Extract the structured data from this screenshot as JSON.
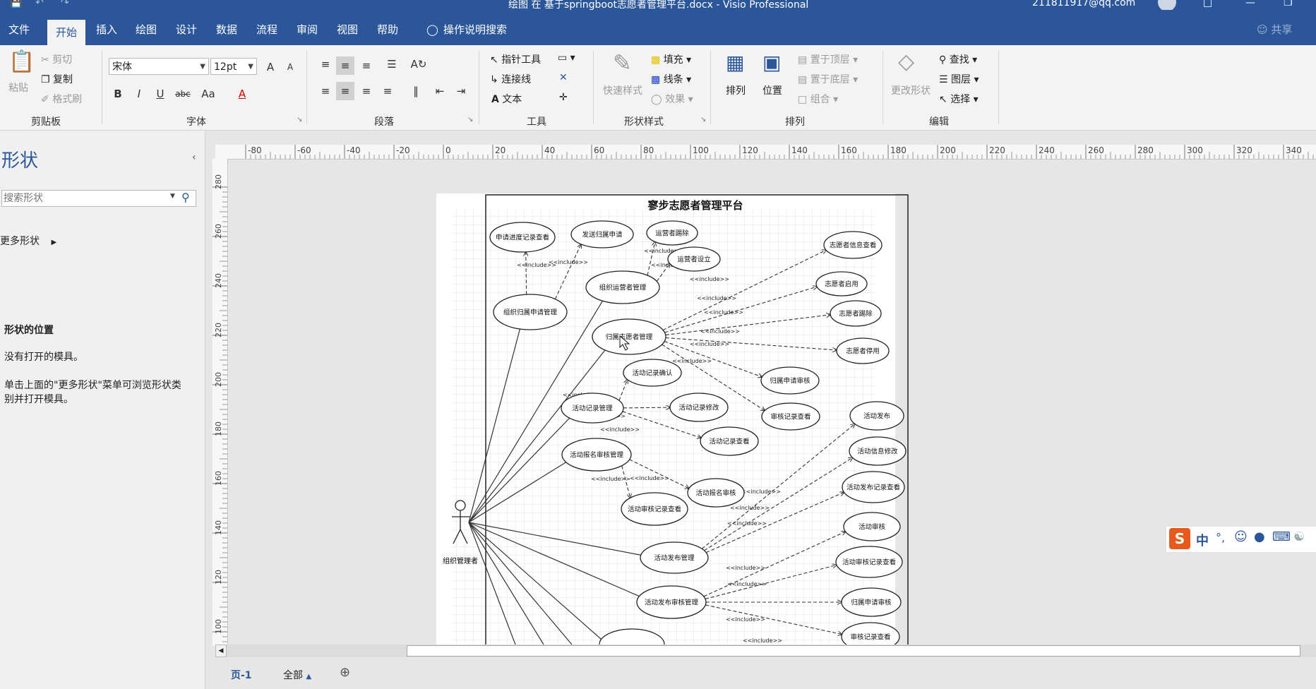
{
  "window": {
    "title": "绘图 在 基于springboot志愿者管理平台.docx  -  Visio Professional",
    "account": "211811917@qq.com"
  },
  "menu": {
    "tabs": [
      "文件",
      "开始",
      "插入",
      "绘图",
      "设计",
      "数据",
      "流程",
      "审阅",
      "视图",
      "帮助"
    ],
    "active": "开始",
    "tell_me": "操作说明搜索",
    "share": "共享"
  },
  "ribbon": {
    "clipboard": {
      "paste": "粘贴",
      "cut": "剪切",
      "copy": "复制",
      "format_painter": "格式刷",
      "label": "剪贴板"
    },
    "font": {
      "name": "宋体",
      "size": "12pt",
      "label": "字体",
      "grow": "A",
      "shrink": "A",
      "bold": "B",
      "italic": "I",
      "underline": "U",
      "strike": "abc",
      "case": "Aa",
      "color": "A"
    },
    "paragraph": {
      "label": "段落"
    },
    "tools": {
      "pointer": "指针工具",
      "connector": "连接线",
      "text": "文本",
      "label": "工具"
    },
    "shape_styles": {
      "quick": "快速样式",
      "fill": "填充",
      "line": "线条",
      "effect": "效果",
      "label": "形状样式"
    },
    "arrange": {
      "align": "排列",
      "position": "位置",
      "bring_front": "置于顶层",
      "send_back": "置于底层",
      "group": "组合",
      "label": "排列"
    },
    "editing": {
      "change_shape": "更改形状",
      "find": "查找",
      "layers": "图层",
      "select": "选择",
      "label": "编辑"
    }
  },
  "shapes_pane": {
    "title": "形状",
    "search_placeholder": "搜索形状",
    "more_shapes": "更多形状",
    "location_heading": "形状的位置",
    "no_stencils": "没有打开的模具。",
    "hint_line1": "单击上面的\"更多形状\"菜单可浏览形状类",
    "hint_line2": "别并打开模具。"
  },
  "ruler": {
    "h_labels": [
      "-80",
      "-60",
      "-40",
      "-20",
      "0",
      "20",
      "40",
      "60",
      "80",
      "100",
      "120",
      "140",
      "160",
      "180",
      "200",
      "220",
      "240",
      "260",
      "280",
      "300",
      "320",
      "340"
    ],
    "v_labels": [
      "280",
      "260",
      "240",
      "220",
      "200",
      "180",
      "160",
      "140",
      "120",
      "100"
    ]
  },
  "diagram": {
    "title": "寥步志愿者管理平台",
    "actor": "组织管理者",
    "include": "<<include>>",
    "usecases": {
      "uc1": "申请进度记录查看",
      "uc2": "发送归属申请",
      "uc3": "运营者踢除",
      "uc4": "运营者设立",
      "uc5": "组织运营者管理",
      "uc6": "组织归属申请管理",
      "uc7": "归属志愿者管理",
      "uc8": "志愿者信息查看",
      "uc9": "志愿者启用",
      "uc10": "志愿者踢除",
      "uc11": "志愿者停用",
      "uc12": "归属申请审核",
      "uc13": "审核记录查看",
      "uc14": "活动记录确认",
      "uc15": "活动记录管理",
      "uc16": "活动记录修改",
      "uc17": "活动记录查看",
      "uc18": "活动报名审核管理",
      "uc19": "活动报名审核",
      "uc20": "活动审核记录查看",
      "uc21": "活动发布",
      "uc22": "活动信息修改",
      "uc23": "活动发布记录查看",
      "uc24": "活动审核",
      "uc25": "活动发布管理",
      "uc26": "活动审核记录查看",
      "uc27": "活动发布审核管理",
      "uc28": "归属申请审核",
      "uc29": "审核记录查看"
    }
  },
  "bottom": {
    "page_tab": "页-1",
    "all": "全部"
  },
  "ime": {
    "label": "中"
  },
  "colors": {
    "brand": "#2b579a",
    "ribbon": "#f3f3f3",
    "pane": "#f0f0f0",
    "canvas": "#e6e6e6"
  }
}
